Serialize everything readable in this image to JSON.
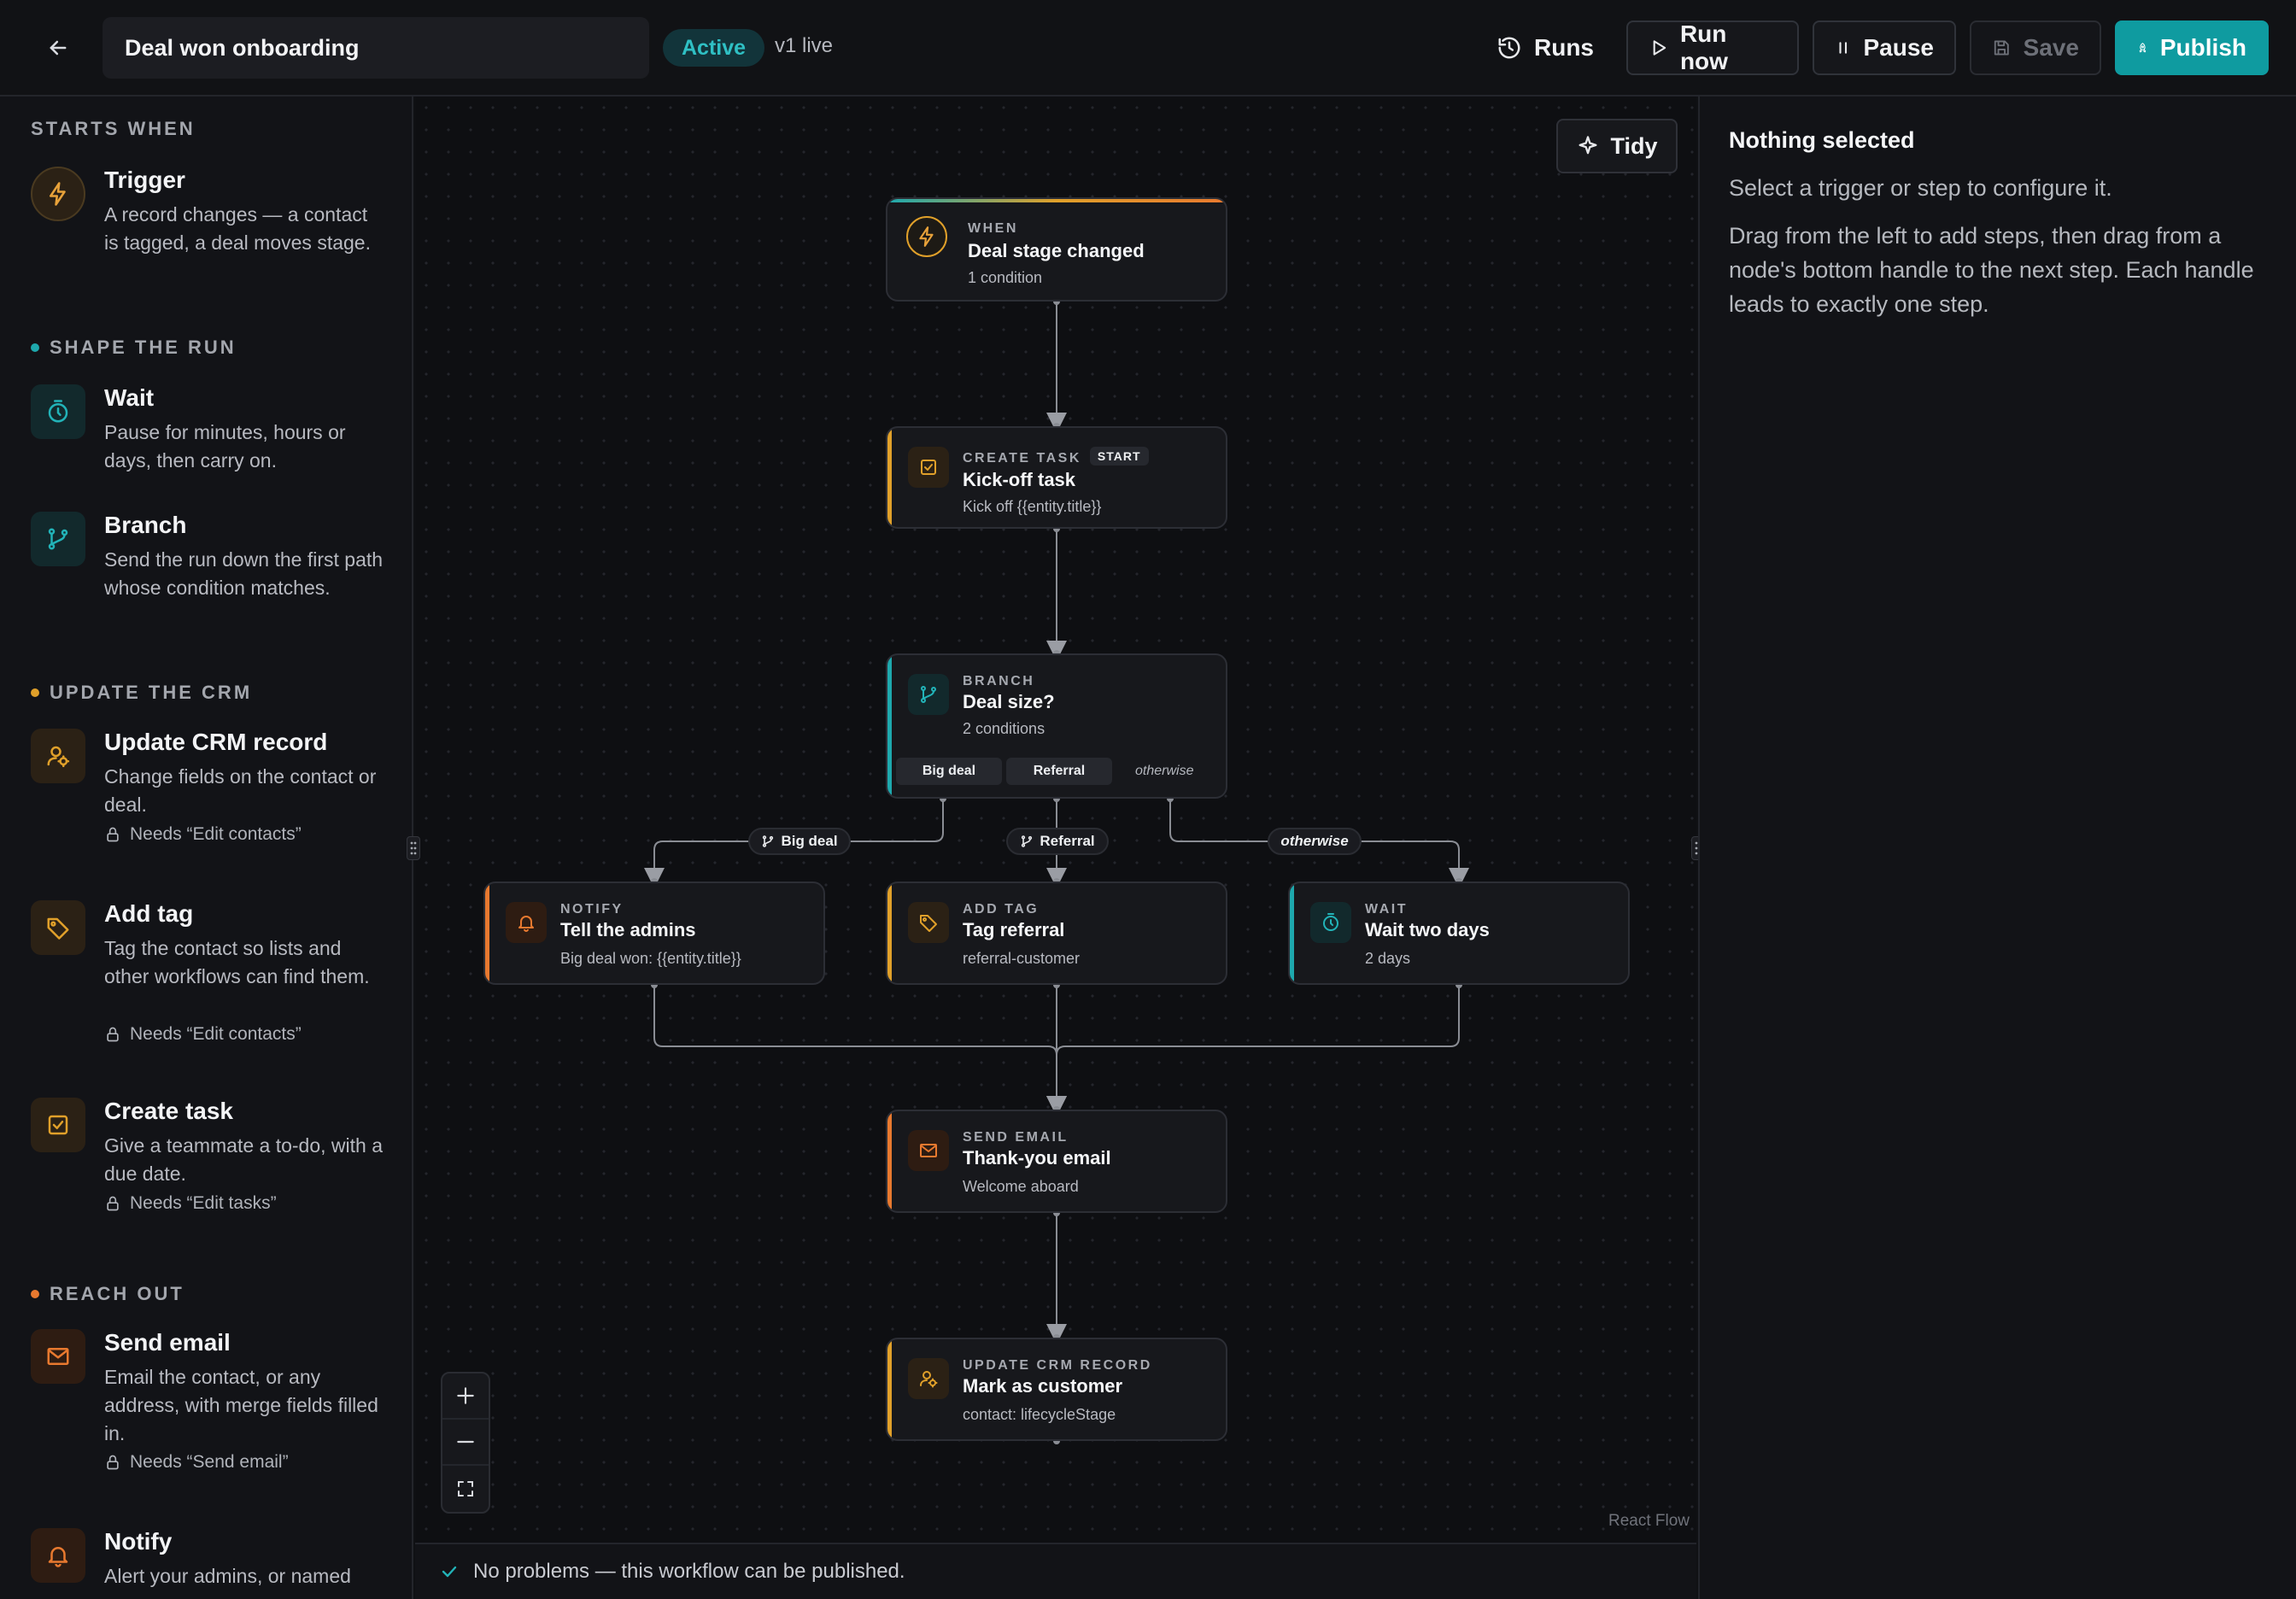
{
  "header": {
    "workflow_name": "Deal won onboarding",
    "status": "Active",
    "version": "v1 live",
    "buttons": {
      "runs": "Runs",
      "run_now": "Run now",
      "pause": "Pause",
      "save": "Save",
      "publish": "Publish"
    }
  },
  "palette": {
    "sections": [
      {
        "id": "starts",
        "label": "STARTS WHEN",
        "color": ""
      },
      {
        "id": "shape",
        "label": "SHAPE THE RUN",
        "color": "#1ea8ad"
      },
      {
        "id": "crm",
        "label": "UPDATE THE CRM",
        "color": "#e0a02a"
      },
      {
        "id": "reach",
        "label": "REACH OUT",
        "color": "#e8792f"
      }
    ],
    "items": [
      {
        "id": "trigger",
        "icon": "lightning-icon",
        "title": "Trigger",
        "desc": "A record changes — a contact is tagged, a deal moves stage.",
        "perm": ""
      },
      {
        "id": "wait",
        "icon": "timer-icon",
        "title": "Wait",
        "desc": "Pause for minutes, hours or days, then carry on.",
        "perm": ""
      },
      {
        "id": "branch",
        "icon": "git-branch-icon",
        "title": "Branch",
        "desc": "Send the run down the first path whose condition matches.",
        "perm": ""
      },
      {
        "id": "update",
        "icon": "user-gear-icon",
        "title": "Update CRM record",
        "desc": "Change fields on the contact or deal.",
        "perm": "Needs “Edit contacts”"
      },
      {
        "id": "tag",
        "icon": "tag-icon",
        "title": "Add tag",
        "desc": "Tag the contact so lists and other workflows can find them.",
        "perm": "Needs “Edit contacts”"
      },
      {
        "id": "task",
        "icon": "checkbox-icon",
        "title": "Create task",
        "desc": "Give a teammate a to-do, with a due date.",
        "perm": "Needs “Edit tasks”"
      },
      {
        "id": "email",
        "icon": "mail-icon",
        "title": "Send email",
        "desc": "Email the contact, or any address, with merge fields filled in.",
        "perm": "Needs “Send email”"
      },
      {
        "id": "notify",
        "icon": "bell-icon",
        "title": "Notify",
        "desc": "Alert your admins, or named",
        "perm": ""
      }
    ]
  },
  "canvas": {
    "tidy": "Tidy",
    "attribution": "React Flow",
    "nodes": {
      "trigger": {
        "kind": "WHEN",
        "title": "Deal stage changed",
        "sub": "1 condition"
      },
      "kickoff": {
        "kind": "CREATE TASK",
        "badge": "START",
        "title": "Kick-off task",
        "sub": "Kick off {{entity.title}}"
      },
      "branch": {
        "kind": "BRANCH",
        "title": "Deal size?",
        "sub": "2 conditions",
        "paths": [
          "Big deal",
          "Referral"
        ],
        "otherwise": "otherwise"
      },
      "notify": {
        "kind": "NOTIFY",
        "title": "Tell the admins",
        "sub": "Big deal won: {{entity.title}}"
      },
      "tag": {
        "kind": "ADD TAG",
        "title": "Tag referral",
        "sub": "referral-customer"
      },
      "wait": {
        "kind": "WAIT",
        "title": "Wait two days",
        "sub": "2 days"
      },
      "email": {
        "kind": "SEND EMAIL",
        "title": "Thank-you email",
        "sub": "Welcome aboard"
      },
      "update": {
        "kind": "UPDATE CRM RECORD",
        "title": "Mark as customer",
        "sub": "contact: lifecycleStage"
      }
    },
    "edge_labels": {
      "big": "Big deal",
      "referral": "Referral",
      "otherwise": "otherwise"
    }
  },
  "statusbar": {
    "message": "No problems — this workflow can be published."
  },
  "inspector": {
    "title": "Nothing selected",
    "line1": "Select a trigger or step to configure it.",
    "line2": "Drag from the left to add steps, then drag from a node's bottom handle to the next step. Each handle leads to exactly one step."
  },
  "colors": {
    "teal": "#1ea8ad",
    "amber": "#e0a02a",
    "orange": "#e8792f",
    "publish": "#0f9ba0"
  }
}
